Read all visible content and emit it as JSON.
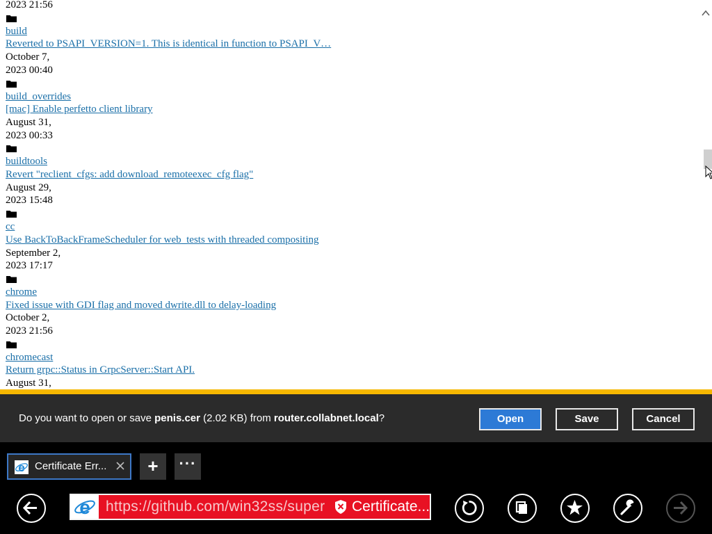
{
  "listing": {
    "top_partial_date": "2023 21:56",
    "entries": [
      {
        "name": "build",
        "commit": "Reverted to PSAPI_VERSION=1. This is identical in function to PSAPI_V…",
        "date1": "October 7,",
        "date2": "2023 00:40"
      },
      {
        "name": "build_overrides",
        "commit": "[mac] Enable perfetto client library",
        "date1": "August 31,",
        "date2": "2023 00:33"
      },
      {
        "name": "buildtools",
        "commit": "Revert \"reclient_cfgs: add download_remoteexec_cfg flag\"",
        "date1": "August 29,",
        "date2": "2023 15:48"
      },
      {
        "name": "cc",
        "commit": "Use BackToBackFrameScheduler for web_tests with threaded compositing",
        "date1": "September 2,",
        "date2": "2023 17:17"
      },
      {
        "name": "chrome",
        "commit": "Fixed issue with GDI flag and moved dwrite.dll to delay-loading",
        "date1": "October 2,",
        "date2": "2023 21:56"
      },
      {
        "name": "chromecast",
        "commit": "Return grpc::Status in GrpcServer::Start API.",
        "date1": "August 31,",
        "date2": ""
      }
    ]
  },
  "notification": {
    "prefix": "Do you want to open or save ",
    "filename": "penis.cer",
    "size": " (2.02 KB) from ",
    "host": "router.collabnet.local",
    "suffix": "?",
    "open_label": "Open",
    "save_label": "Save",
    "cancel_label": "Cancel",
    "accent_color": "#f5b700",
    "primary_button_color": "#2d7ad6"
  },
  "tabs": {
    "active_tab_title": "Certificate Err...",
    "new_tab_label": "+",
    "more_label": "···"
  },
  "addressbar": {
    "url": "https://github.com/win32ss/super",
    "certificate_label": "Certificate...",
    "error_color": "#e81123"
  },
  "icons": {
    "folder": "folder-icon",
    "back": "back-arrow-icon",
    "refresh": "refresh-icon",
    "tabs": "tabs-icon",
    "favorites": "star-icon",
    "tools": "wrench-icon",
    "forward": "forward-arrow-icon",
    "site": "ie-logo-icon",
    "certificate": "shield-x-icon"
  }
}
